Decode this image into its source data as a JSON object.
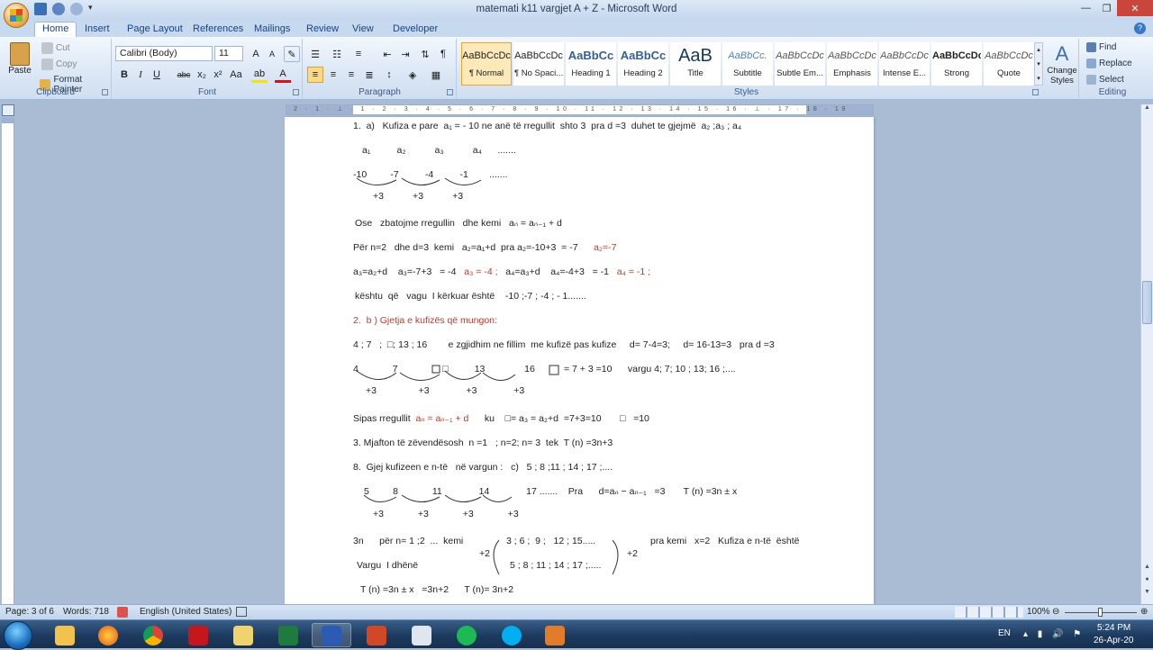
{
  "window": {
    "title": "matemati k11 vargjet  A + Z  -  Microsoft Word"
  },
  "tabs": [
    "Home",
    "Insert",
    "Page Layout",
    "References",
    "Mailings",
    "Review",
    "View",
    "Developer"
  ],
  "clipboard": {
    "paste": "Paste",
    "cut": "Cut",
    "copy": "Copy",
    "format_painter": "Format Painter",
    "label": "Clipboard"
  },
  "font": {
    "name": "Calibri (Body)",
    "size": "11",
    "label": "Font"
  },
  "paragraph": {
    "label": "Paragraph"
  },
  "styles": {
    "label": "Styles",
    "items": [
      {
        "preview": "AaBbCcDc",
        "name": "¶ Normal"
      },
      {
        "preview": "AaBbCcDc",
        "name": "¶ No Spaci..."
      },
      {
        "preview": "AaBbCc",
        "name": "Heading 1"
      },
      {
        "preview": "AaBbCc",
        "name": "Heading 2"
      },
      {
        "preview": "AaB",
        "name": "Title"
      },
      {
        "preview": "AaBbCc.",
        "name": "Subtitle"
      },
      {
        "preview": "AaBbCcDc",
        "name": "Subtle Em..."
      },
      {
        "preview": "AaBbCcDc",
        "name": "Emphasis"
      },
      {
        "preview": "AaBbCcDc",
        "name": "Intense E..."
      },
      {
        "preview": "AaBbCcDc",
        "name": "Strong"
      },
      {
        "preview": "AaBbCcDc",
        "name": "Quote"
      }
    ],
    "change": "Change Styles"
  },
  "editing": {
    "find": "Find",
    "replace": "Replace",
    "select": "Select",
    "label": "Editing"
  },
  "ruler": {
    "numbers": "2 · 1 · ⊥ · 1 · 2 · 3 · 4 · 5 · 6 · 7 · 8 · 9 · 10 · 11 · 12 · 13 · 14 · 15 · 16 · ⊥ · 17 · 18 · 19"
  },
  "doc": {
    "l1": "1.  a)   Kufiza e pare  a₁ = - 10 ne anë të rregullit  shto 3  pra d =3  duhet te gjejmë  a₂ ;a₃ ; a₄",
    "l2": "a₁          a₂           a₃           a₄      .......",
    "l3": "-10         -7          -4          -1        .......",
    "l4": "+3           +3           +3",
    "l5": "Ose   zbatojme rregullin   dhe kemi   aₙ = aₙ₋₁ + d",
    "l6a": "Për n=2   dhe d=3  kemi   a₂=a₁+d  pra a₂=-10+3  = -7",
    "l6b": "a₂=-7",
    "l7a": "a₃=a₂+d    a₃=-7+3   = -4   ",
    "l7b": "a₃ = -4 ;",
    "l7c": "   a₄=a₃+d    a₄=-4+3   = -1   ",
    "l7d": "a₄ = -1 ;",
    "l8": "kështu  që   vagu  I kërkuar është    -10 ;-7 ; -4 ; - 1.......",
    "l9": "2.  b ) Gjetja e kufizës që mungon:",
    "l10": "4 ; 7   ;  □; 13 ; 16        e zgjidhim ne fillim  me kufizë pas kufize     d= 7-4=3;     d= 16-13=3   pra d =3",
    "l11": "4             7                 □          13               16",
    "l11b": "= 7 + 3 =10      vargu 4; 7; 10 ; 13; 16 ;....",
    "l12": "+3                +3              +3              +3",
    "l13a": "Sipas rregullit  ",
    "l13b": "aₙ = aₙ₋₁ + d",
    "l13c": "      ku    □= a₃ = a₂+d  =7+3=10       □   =10",
    "l14": "3. Mjafton të zëvendësosh  n =1   ; n=2; n= 3  tek  T (n) =3n+3",
    "l15": "8.  Gjej kufizeen e n-të   në vargun :   c)   5 ; 8 ;11 ; 14 ; 17 ;....",
    "l16": "5         8             11              14              17 .......    Pra      d=aₙ − aₙ₋₁   =3       T (n) =3n ± x",
    "l17": "+3             +3             +3             +3",
    "l18a": "3n      për n= 1 ;2  ...  kemi",
    "l18b": "3 ; 6 ;  9 ;   12 ; 15.....",
    "l18c": "pra kemi   x=2   Kufiza e n-të  është",
    "l19a": "Vargu  I dhënë",
    "l19b": "5 ; 8 ; 11 ; 14 ; 17 ;.....",
    "l20": "T (n) =3n ± x   =3n+2      T (n)= 3n+2",
    "plus2": "+2"
  },
  "status": {
    "page": "Page: 3 of 6",
    "words": "Words: 718",
    "language": "English (United States)",
    "zoom": "100%"
  },
  "tray": {
    "lang": "EN",
    "time": "5:24 PM",
    "date": "26-Apr-20"
  }
}
